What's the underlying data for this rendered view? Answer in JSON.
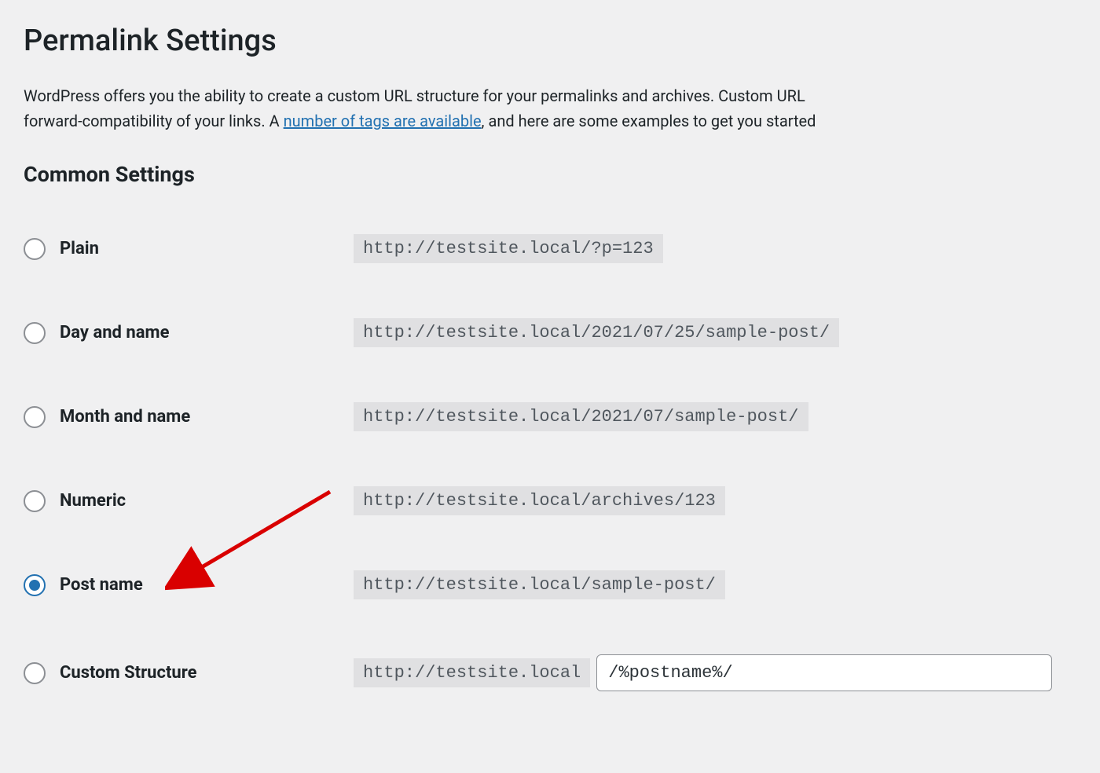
{
  "page": {
    "title": "Permalink Settings",
    "description_part1": "WordPress offers you the ability to create a custom URL structure for your permalinks and archives. Custom URL",
    "description_part2": "forward-compatibility of your links. A ",
    "description_link": "number of tags are available",
    "description_part3": ", and here are some examples to get you started",
    "section_title": "Common Settings"
  },
  "options": [
    {
      "label": "Plain",
      "example": "http://testsite.local/?p=123",
      "checked": false,
      "has_input": false
    },
    {
      "label": "Day and name",
      "example": "http://testsite.local/2021/07/25/sample-post/",
      "checked": false,
      "has_input": false
    },
    {
      "label": "Month and name",
      "example": "http://testsite.local/2021/07/sample-post/",
      "checked": false,
      "has_input": false
    },
    {
      "label": "Numeric",
      "example": "http://testsite.local/archives/123",
      "checked": false,
      "has_input": false
    },
    {
      "label": "Post name",
      "example": "http://testsite.local/sample-post/",
      "checked": true,
      "has_input": false
    },
    {
      "label": "Custom Structure",
      "example": "http://testsite.local",
      "checked": false,
      "has_input": true,
      "input_value": "/%postname%/"
    }
  ]
}
